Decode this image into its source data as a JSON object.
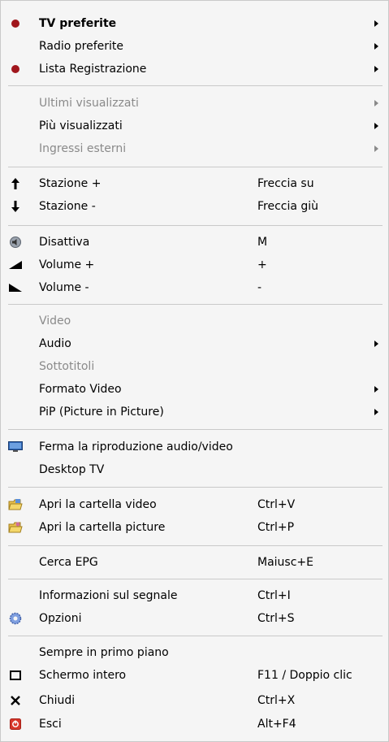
{
  "menu": {
    "items": [
      {
        "label": "TV preferite",
        "shortcut": "",
        "icon": "red-dot-icon",
        "submenu": true,
        "disabled": false,
        "bold": true
      },
      {
        "label": "Radio preferite",
        "shortcut": "",
        "icon": "",
        "submenu": true,
        "disabled": false,
        "bold": false
      },
      {
        "label": "Lista Registrazione",
        "shortcut": "",
        "icon": "red-dot-icon",
        "submenu": true,
        "disabled": false,
        "bold": false
      },
      {
        "label": "Ultimi visualizzati",
        "shortcut": "",
        "icon": "",
        "submenu": true,
        "disabled": true,
        "bold": false
      },
      {
        "label": "Più visualizzati",
        "shortcut": "",
        "icon": "",
        "submenu": true,
        "disabled": false,
        "bold": false
      },
      {
        "label": "Ingressi esterni",
        "shortcut": "",
        "icon": "",
        "submenu": true,
        "disabled": true,
        "bold": false
      },
      {
        "label": "Stazione +",
        "shortcut": "Freccia su",
        "icon": "arrow-up-icon",
        "submenu": false,
        "disabled": false,
        "bold": false
      },
      {
        "label": "Stazione -",
        "shortcut": "Freccia giù",
        "icon": "arrow-down-icon",
        "submenu": false,
        "disabled": false,
        "bold": false
      },
      {
        "label": "Disattiva",
        "shortcut": "M",
        "icon": "mute-icon",
        "submenu": false,
        "disabled": false,
        "bold": false
      },
      {
        "label": "Volume +",
        "shortcut": "+",
        "icon": "volume-up-icon",
        "submenu": false,
        "disabled": false,
        "bold": false
      },
      {
        "label": "Volume -",
        "shortcut": "-",
        "icon": "volume-down-icon",
        "submenu": false,
        "disabled": false,
        "bold": false
      },
      {
        "label": "Video",
        "shortcut": "",
        "icon": "",
        "submenu": false,
        "disabled": true,
        "bold": false
      },
      {
        "label": "Audio",
        "shortcut": "",
        "icon": "",
        "submenu": true,
        "disabled": false,
        "bold": false
      },
      {
        "label": "Sottotitoli",
        "shortcut": "",
        "icon": "",
        "submenu": false,
        "disabled": true,
        "bold": false
      },
      {
        "label": "Formato Video",
        "shortcut": "",
        "icon": "",
        "submenu": true,
        "disabled": false,
        "bold": false
      },
      {
        "label": "PiP (Picture in Picture)",
        "shortcut": "",
        "icon": "",
        "submenu": true,
        "disabled": false,
        "bold": false
      },
      {
        "label": "Ferma la riproduzione audio/video",
        "shortcut": "",
        "icon": "monitor-icon",
        "submenu": false,
        "disabled": false,
        "bold": false
      },
      {
        "label": "Desktop TV",
        "shortcut": "",
        "icon": "",
        "submenu": false,
        "disabled": false,
        "bold": false
      },
      {
        "label": "Apri la cartella video",
        "shortcut": "Ctrl+V",
        "icon": "folder-video-icon",
        "submenu": false,
        "disabled": false,
        "bold": false
      },
      {
        "label": "Apri la cartella picture",
        "shortcut": "Ctrl+P",
        "icon": "folder-picture-icon",
        "submenu": false,
        "disabled": false,
        "bold": false
      },
      {
        "label": "Cerca EPG",
        "shortcut": "Maiusc+E",
        "icon": "",
        "submenu": false,
        "disabled": false,
        "bold": false
      },
      {
        "label": "Informazioni sul segnale",
        "shortcut": "Ctrl+I",
        "icon": "",
        "submenu": false,
        "disabled": false,
        "bold": false
      },
      {
        "label": "Opzioni",
        "shortcut": "Ctrl+S",
        "icon": "gear-icon",
        "submenu": false,
        "disabled": false,
        "bold": false
      },
      {
        "label": "Sempre in primo piano",
        "shortcut": "",
        "icon": "",
        "submenu": false,
        "disabled": false,
        "bold": false
      },
      {
        "label": "Schermo intero",
        "shortcut": "F11 / Doppio clic",
        "icon": "fullscreen-icon",
        "submenu": false,
        "disabled": false,
        "bold": false
      },
      {
        "label": "Chiudi",
        "shortcut": "Ctrl+X",
        "icon": "close-icon",
        "submenu": false,
        "disabled": false,
        "bold": false
      },
      {
        "label": "Esci",
        "shortcut": "Alt+F4",
        "icon": "exit-icon",
        "submenu": false,
        "disabled": false,
        "bold": false
      }
    ]
  },
  "colors": {
    "menu_background": "#f5f5f5",
    "separator": "#c9c9c9",
    "disabled_text": "#8a8a8a",
    "red_dot": "#a0161c",
    "exit_icon": "#d8372b"
  }
}
